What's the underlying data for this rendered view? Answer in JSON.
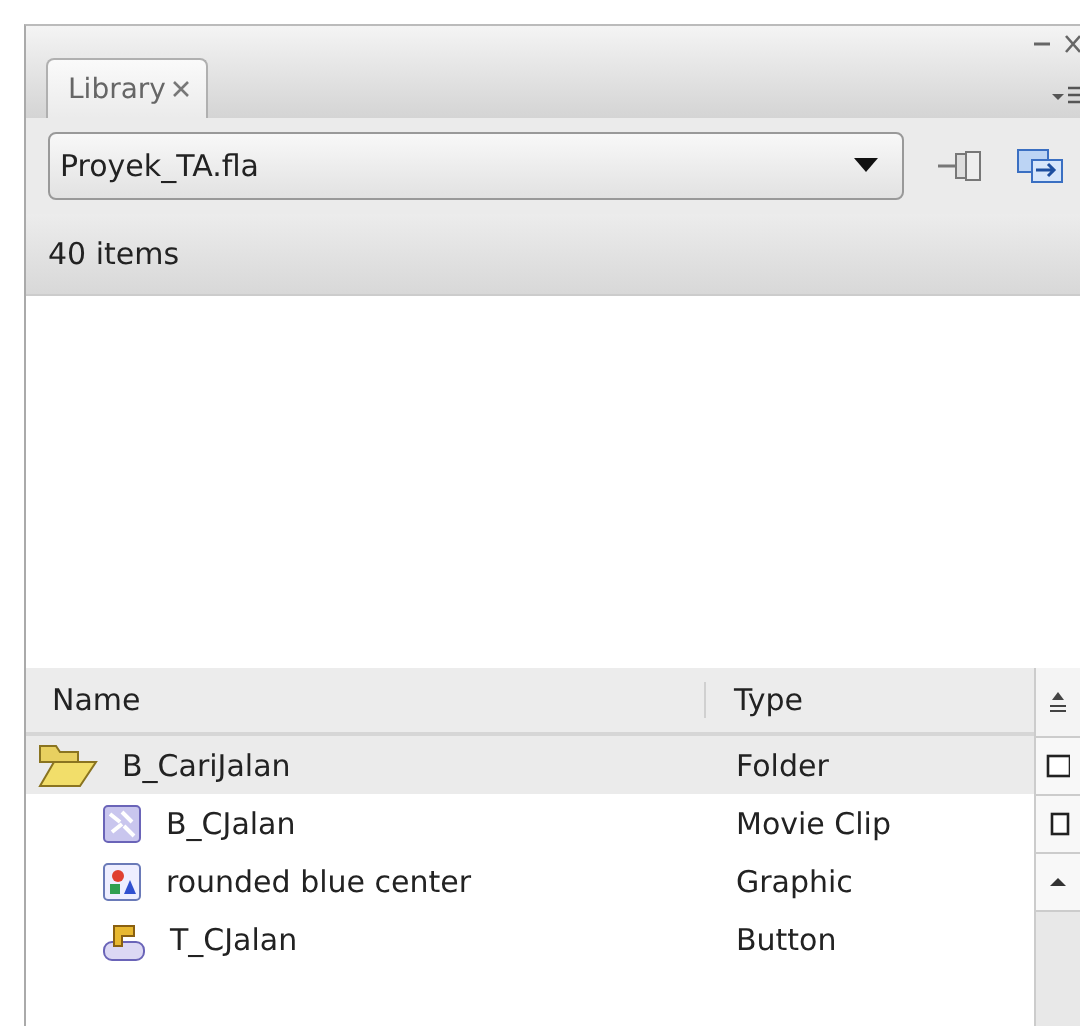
{
  "panel": {
    "tab": {
      "label": "Library",
      "selected": true
    },
    "document": "Proyek_TA.fla",
    "item_count": "40 items"
  },
  "table": {
    "columns": [
      "Name",
      "Type"
    ],
    "rows": [
      {
        "kind": "folder",
        "name": "B_CariJalan",
        "type": "Folder",
        "selected": true,
        "expanded": true,
        "children": [
          {
            "kind": "movie_clip",
            "name": "B_CJalan",
            "type": "Movie Clip",
            "selected": false
          },
          {
            "kind": "graphic",
            "name": "rounded blue center",
            "type": "Graphic",
            "selected": false
          },
          {
            "kind": "button",
            "name": "T_CJalan",
            "type": "Button",
            "selected": false
          }
        ]
      }
    ]
  }
}
